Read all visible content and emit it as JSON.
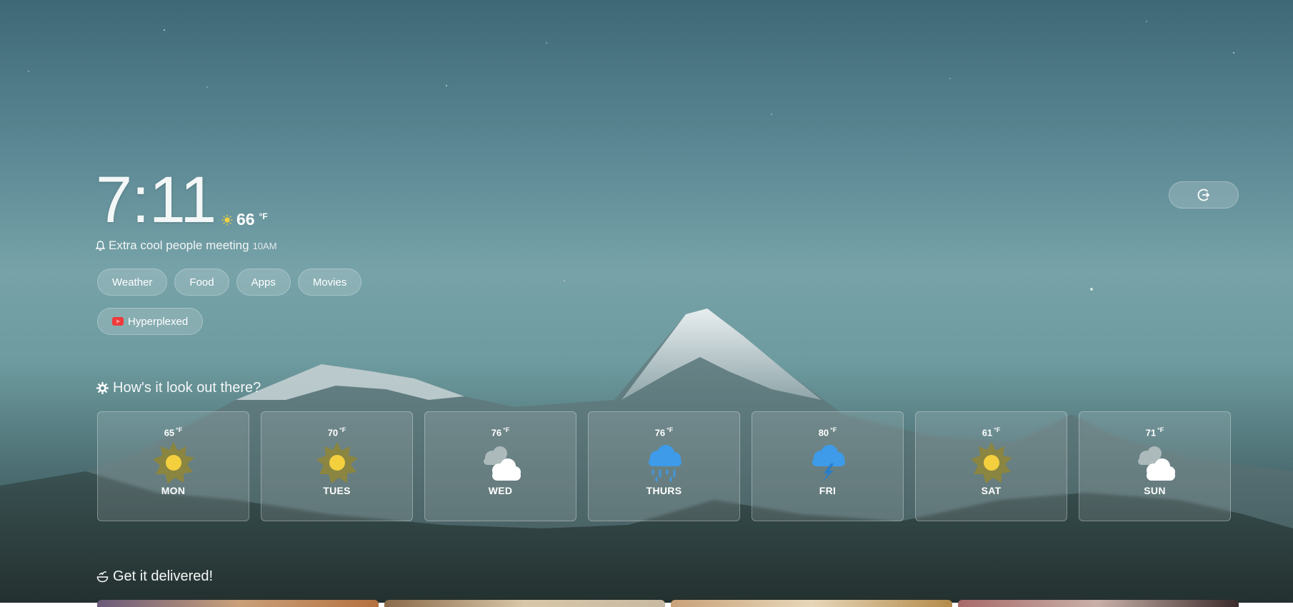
{
  "clock": {
    "time": "7:11"
  },
  "current_weather": {
    "icon": "sun-icon",
    "temp": "66",
    "unit": "°F"
  },
  "reminder": {
    "icon": "bell-icon",
    "title": "Extra cool people meeting",
    "time": "10AM"
  },
  "chips": [
    {
      "label": "Weather"
    },
    {
      "label": "Food"
    },
    {
      "label": "Apps"
    },
    {
      "label": "Movies"
    }
  ],
  "pinned": {
    "label": "Hyperplexed",
    "icon": "youtube-icon",
    "color": "#ff3b3b"
  },
  "logout": {
    "icon": "logout-icon"
  },
  "weather_section": {
    "icon": "sun-gear-icon",
    "title": "How's it look out there?"
  },
  "forecast": [
    {
      "day": "MON",
      "temp": "65",
      "unit": "°F",
      "icon": "sunny"
    },
    {
      "day": "TUES",
      "temp": "70",
      "unit": "°F",
      "icon": "sunny"
    },
    {
      "day": "WED",
      "temp": "76",
      "unit": "°F",
      "icon": "cloudy"
    },
    {
      "day": "THURS",
      "temp": "76",
      "unit": "°F",
      "icon": "rainy"
    },
    {
      "day": "FRI",
      "temp": "80",
      "unit": "°F",
      "icon": "stormy"
    },
    {
      "day": "SAT",
      "temp": "61",
      "unit": "°F",
      "icon": "sunny"
    },
    {
      "day": "SUN",
      "temp": "71",
      "unit": "°F",
      "icon": "cloudy"
    }
  ],
  "food_section": {
    "icon": "bowl-icon",
    "title": "Get it delivered!"
  },
  "colors": {
    "sun": "#f4d03f",
    "sun_rays": "#8a8540",
    "rain": "#3d9be9",
    "cloud": "#ffffff",
    "cloud_back": "#b8c4c5"
  }
}
